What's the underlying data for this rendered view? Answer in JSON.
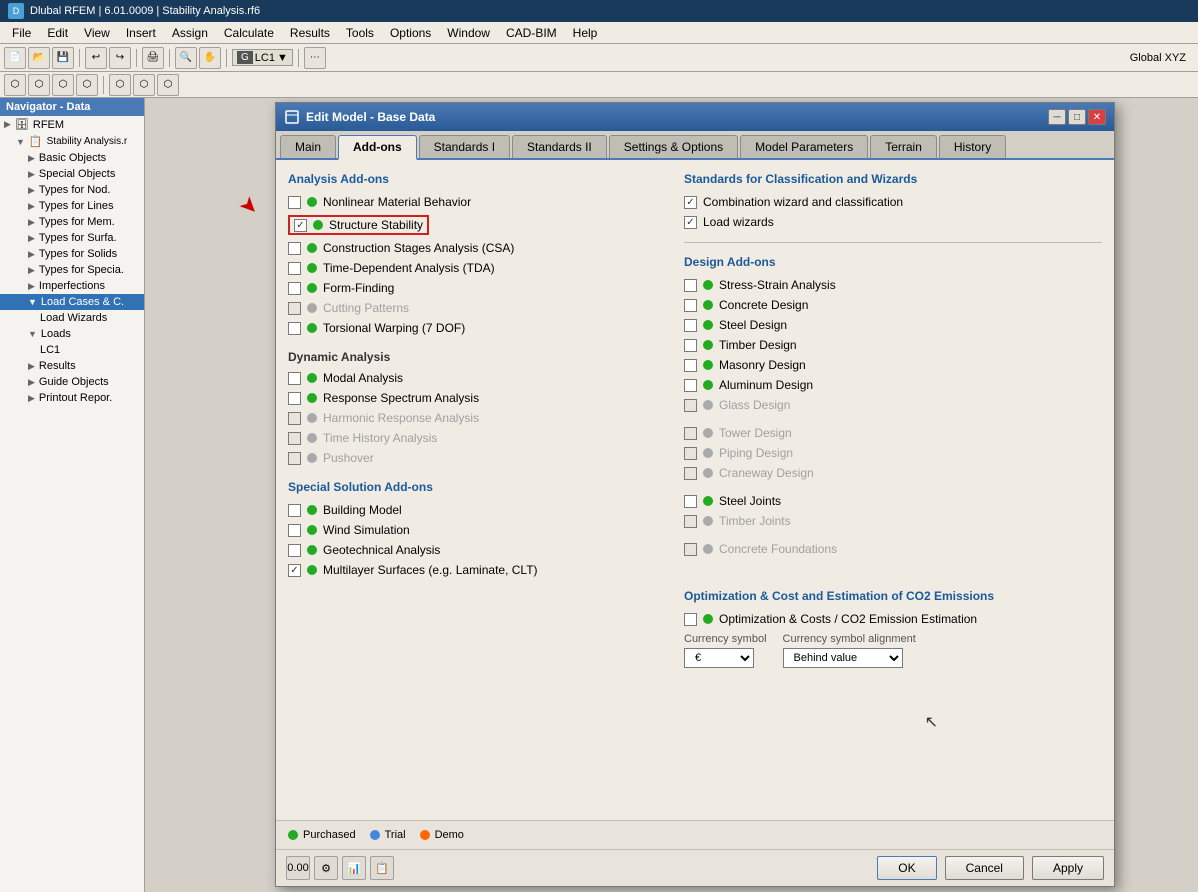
{
  "titleBar": {
    "icon": "D",
    "text": "Dlubal RFEM | 6.01.0009 | Stability Analysis.rf6"
  },
  "menuBar": {
    "items": [
      "File",
      "Edit",
      "View",
      "Insert",
      "Assign",
      "Calculate",
      "Results",
      "Tools",
      "Options",
      "Window",
      "CAD-BIM",
      "Help"
    ]
  },
  "navigator": {
    "header": "Navigator - Data",
    "items": [
      {
        "label": "RFEM",
        "level": 0,
        "icon": "▶",
        "type": "root"
      },
      {
        "label": "Stability Analysis.r",
        "level": 1,
        "icon": "▼",
        "type": "file"
      },
      {
        "label": "Basic Objects",
        "level": 2,
        "icon": "▶",
        "type": "folder"
      },
      {
        "label": "Special Objects",
        "level": 2,
        "icon": "▶",
        "type": "folder"
      },
      {
        "label": "Types for Nod.",
        "level": 2,
        "icon": "▶",
        "type": "folder"
      },
      {
        "label": "Types for Lines",
        "level": 2,
        "icon": "▶",
        "type": "folder"
      },
      {
        "label": "Types for Mem.",
        "level": 2,
        "icon": "▶",
        "type": "folder"
      },
      {
        "label": "Types for Surfa.",
        "level": 2,
        "icon": "▶",
        "type": "folder"
      },
      {
        "label": "Types for Solids",
        "level": 2,
        "icon": "▶",
        "type": "folder"
      },
      {
        "label": "Types for Specia.",
        "level": 2,
        "icon": "▶",
        "type": "folder"
      },
      {
        "label": "Imperfections",
        "level": 2,
        "icon": "▶",
        "type": "folder"
      },
      {
        "label": "Load Cases & C.",
        "level": 2,
        "icon": "▼",
        "type": "folder",
        "selected": true
      },
      {
        "label": "Load Wizards",
        "level": 3,
        "icon": "",
        "type": "item"
      },
      {
        "label": "Loads",
        "level": 2,
        "icon": "▼",
        "type": "folder"
      },
      {
        "label": "LC1",
        "level": 3,
        "icon": "",
        "type": "item"
      },
      {
        "label": "Results",
        "level": 2,
        "icon": "▶",
        "type": "folder"
      },
      {
        "label": "Guide Objects",
        "level": 2,
        "icon": "▶",
        "type": "folder"
      },
      {
        "label": "Printout Repor.",
        "level": 2,
        "icon": "▶",
        "type": "folder"
      }
    ]
  },
  "dialog": {
    "title": "Edit Model - Base Data",
    "tabs": [
      "Main",
      "Add-ons",
      "Standards I",
      "Standards II",
      "Settings & Options",
      "Model Parameters",
      "Terrain",
      "History"
    ],
    "activeTab": "Add-ons",
    "leftPanel": {
      "analysisTitle": "Analysis Add-ons",
      "addons": [
        {
          "id": "nonlinear",
          "label": "Nonlinear Material Behavior",
          "checked": false,
          "dot": "green",
          "disabled": false
        },
        {
          "id": "stability",
          "label": "Structure Stability",
          "checked": true,
          "dot": "green",
          "disabled": false,
          "highlighted": true
        },
        {
          "id": "csa",
          "label": "Construction Stages Analysis (CSA)",
          "checked": false,
          "dot": "green",
          "disabled": false
        },
        {
          "id": "tda",
          "label": "Time-Dependent Analysis (TDA)",
          "checked": false,
          "dot": "green",
          "disabled": false
        },
        {
          "id": "formfinding",
          "label": "Form-Finding",
          "checked": false,
          "dot": "green",
          "disabled": false
        },
        {
          "id": "cutting",
          "label": "Cutting Patterns",
          "checked": false,
          "dot": "gray",
          "disabled": true
        },
        {
          "id": "torsional",
          "label": "Torsional Warping (7 DOF)",
          "checked": false,
          "dot": "green",
          "disabled": false
        }
      ],
      "dynamicTitle": "Dynamic Analysis",
      "dynamicAddons": [
        {
          "id": "modal",
          "label": "Modal Analysis",
          "checked": false,
          "dot": "green",
          "disabled": false
        },
        {
          "id": "rsa",
          "label": "Response Spectrum Analysis",
          "checked": false,
          "dot": "green",
          "disabled": false
        },
        {
          "id": "harmonic",
          "label": "Harmonic Response Analysis",
          "checked": false,
          "dot": "gray",
          "disabled": true
        },
        {
          "id": "timehistory",
          "label": "Time History Analysis",
          "checked": false,
          "dot": "gray",
          "disabled": true
        },
        {
          "id": "pushover",
          "label": "Pushover",
          "checked": false,
          "dot": "gray",
          "disabled": true
        }
      ],
      "specialTitle": "Special Solution Add-ons",
      "specialAddons": [
        {
          "id": "building",
          "label": "Building Model",
          "checked": false,
          "dot": "green",
          "disabled": false
        },
        {
          "id": "wind",
          "label": "Wind Simulation",
          "checked": false,
          "dot": "green",
          "disabled": false
        },
        {
          "id": "geotech",
          "label": "Geotechnical Analysis",
          "checked": false,
          "dot": "green",
          "disabled": false
        },
        {
          "id": "multilayer",
          "label": "Multilayer Surfaces (e.g. Laminate, CLT)",
          "checked": true,
          "dot": "green",
          "disabled": false
        }
      ]
    },
    "rightPanel": {
      "standardsTitle": "Standards for Classification and Wizards",
      "standardsItems": [
        {
          "id": "combo",
          "label": "Combination wizard and classification",
          "checked": true,
          "dot": null
        },
        {
          "id": "loadwizards",
          "label": "Load wizards",
          "checked": true,
          "dot": null
        }
      ],
      "designTitle": "Design Add-ons",
      "designAddons": [
        {
          "id": "stress",
          "label": "Stress-Strain Analysis",
          "checked": false,
          "dot": "green"
        },
        {
          "id": "concrete",
          "label": "Concrete Design",
          "checked": false,
          "dot": "green"
        },
        {
          "id": "steel",
          "label": "Steel Design",
          "checked": false,
          "dot": "green"
        },
        {
          "id": "timber",
          "label": "Timber Design",
          "checked": false,
          "dot": "green"
        },
        {
          "id": "masonry",
          "label": "Masonry Design",
          "checked": false,
          "dot": "green"
        },
        {
          "id": "aluminum",
          "label": "Aluminum Design",
          "checked": false,
          "dot": "green"
        },
        {
          "id": "glass",
          "label": "Glass Design",
          "checked": false,
          "dot": "gray",
          "disabled": true
        },
        {
          "id": "tower",
          "label": "Tower Design",
          "checked": false,
          "dot": "gray",
          "disabled": true
        },
        {
          "id": "piping",
          "label": "Piping Design",
          "checked": false,
          "dot": "gray",
          "disabled": true
        },
        {
          "id": "craneway",
          "label": "Craneway Design",
          "checked": false,
          "dot": "gray",
          "disabled": true
        },
        {
          "id": "steeljoints",
          "label": "Steel Joints",
          "checked": false,
          "dot": "green"
        },
        {
          "id": "timberjoints",
          "label": "Timber Joints",
          "checked": false,
          "dot": "gray",
          "disabled": true
        },
        {
          "id": "concretefound",
          "label": "Concrete Foundations",
          "checked": false,
          "dot": "gray",
          "disabled": true
        }
      ],
      "optimizationTitle": "Optimization & Cost and Estimation of CO2 Emissions",
      "optimizationItems": [
        {
          "id": "co2",
          "label": "Optimization & Costs / CO2 Emission Estimation",
          "checked": false,
          "dot": "green"
        }
      ],
      "currencySymbolLabel": "Currency symbol",
      "currencyAlignmentLabel": "Currency symbol alignment",
      "currencyValue": "€",
      "currencyAlignment": "Behind value"
    },
    "legend": {
      "purchased": "Purchased",
      "trial": "Trial",
      "demo": "Demo"
    },
    "footer": {
      "ok": "OK",
      "cancel": "Cancel",
      "apply": "Apply"
    }
  },
  "statusBar": {
    "text": "Global XYZ"
  }
}
